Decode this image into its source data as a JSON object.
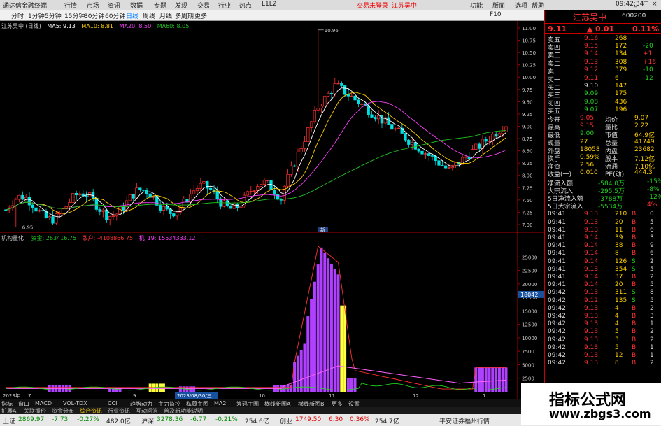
{
  "app": {
    "title": "通达信金融终端",
    "menu": [
      "行情",
      "市场",
      "资讯",
      "数据",
      "专题",
      "发现",
      "交易",
      "行业",
      "热点",
      "L1L2"
    ],
    "trade_login": "交易未登录",
    "stock_name_top": "江苏吴中",
    "right_menu": [
      "功能",
      "版面",
      "选项",
      "帮助"
    ],
    "clock": "09:42:34",
    "window_buttons": [
      "_",
      "□",
      "×"
    ]
  },
  "toolbar": {
    "periods": [
      "分时",
      "1分钟",
      "5分钟",
      "15分钟",
      "30分钟",
      "60分钟",
      "日线",
      "周线",
      "月线",
      "多周期",
      "更多"
    ],
    "selected": "日线",
    "right_icons": [
      "F10"
    ]
  },
  "kline": {
    "legend_name": "江苏吴中 (日线)",
    "ma5": "MA5: 9.13",
    "ma10": "MA10: 8.81",
    "ma20": "MA20: 8.50",
    "ma60": "MA60: 8.05",
    "high_label": "10.96",
    "low_label": "6.95",
    "axis_ticks": [
      "11.00",
      "10.75",
      "10.50",
      "10.25",
      "10.00",
      "9.75",
      "9.50",
      "9.25",
      "9.00",
      "8.75",
      "8.50",
      "8.25",
      "8.00",
      "7.75",
      "7.50",
      "7.25",
      "7.00"
    ],
    "colors": {
      "up": "#ff3030",
      "down": "#00e0e0",
      "ma5": "#ffffff",
      "ma10": "#ffd000",
      "ma20": "#ff40ff",
      "ma60": "#20c020"
    }
  },
  "indicator": {
    "legend_name": "机构量化",
    "legend_a": "资金: 263416.75",
    "legend_b": "散户: -4108866.75",
    "legend_c": "机_19: 15534333.12",
    "axis_ticks": [
      "25000",
      "22500",
      "20000",
      "17500",
      "15000",
      "12500",
      "10000",
      "7500",
      "5000",
      "2500"
    ],
    "cursor_value": "18042",
    "date_label": "2023/08/30/三",
    "x_labels": [
      "2023年",
      "7",
      "9",
      "10",
      "11",
      "12",
      "1"
    ],
    "marker_label": "新"
  },
  "bottom_tabs": [
    "指标",
    "窗口",
    "MACD",
    "VOL-TDX",
    "CCI",
    "趋势动力",
    "主力监控",
    "私募主图",
    "MA2",
    "筹码主图",
    "横线新图A",
    "横线新图B",
    "更多",
    "设置"
  ],
  "bottom_tabs2": [
    "扩展A",
    "关联报价",
    "资金分布",
    "综合资讯",
    "行业资讯",
    "互动问答",
    "普及新功能说明"
  ],
  "quote": {
    "name": "江苏吴中",
    "code": "600200",
    "price": "9.11",
    "change": "0.01",
    "pct": "0.11%",
    "asks": [
      {
        "label": "卖五",
        "price": "9.16",
        "vol": "268",
        "chg": ""
      },
      {
        "label": "卖四",
        "price": "9.15",
        "vol": "172",
        "chg": "-20"
      },
      {
        "label": "卖三",
        "price": "9.14",
        "vol": "134",
        "chg": "+1"
      },
      {
        "label": "卖二",
        "price": "9.13",
        "vol": "308",
        "chg": "+16"
      },
      {
        "label": "卖一",
        "price": "9.12",
        "vol": "379",
        "chg": "-10"
      }
    ],
    "bids": [
      {
        "label": "买一",
        "price": "9.11",
        "vol": "6",
        "chg": "-12"
      },
      {
        "label": "买二",
        "price": "9.10",
        "vol": "147",
        "chg": ""
      },
      {
        "label": "买三",
        "price": "9.09",
        "vol": "175",
        "chg": ""
      },
      {
        "label": "买四",
        "price": "9.08",
        "vol": "436",
        "chg": ""
      },
      {
        "label": "买五",
        "price": "9.07",
        "vol": "196",
        "chg": ""
      }
    ],
    "stats": [
      {
        "k1": "今开",
        "v1": "9.05",
        "k2": "均价",
        "v2": "9.07"
      },
      {
        "k1": "最高",
        "v1": "9.15",
        "k2": "量比",
        "v2": "2.22"
      },
      {
        "k1": "最低",
        "v1": "9.00",
        "k2": "市值",
        "v2": "64.9亿"
      },
      {
        "k1": "现量",
        "v1": "27",
        "k2": "总量",
        "v2": "41749"
      },
      {
        "k1": "外盘",
        "v1": "18058",
        "k2": "内盘",
        "v2": "23682"
      },
      {
        "k1": "换手",
        "v1": "0.59%",
        "k2": "股本",
        "v2": "7.12亿"
      },
      {
        "k1": "净资",
        "v1": "2.56",
        "k2": "流通",
        "v2": "7.10亿"
      },
      {
        "k1": "收益(一)",
        "v1": "0.010",
        "k2": "PE(动)",
        "v2": "444.3"
      }
    ],
    "flows": [
      {
        "label": "净流入额",
        "value": "-584.0万",
        "pct": "-15%"
      },
      {
        "label": "大宗流入",
        "value": "-295.5万",
        "pct": "-8%"
      },
      {
        "label": "5日净流入额",
        "value": "-3788万",
        "pct": "-12%"
      },
      {
        "label": "5日大宗流入",
        "value": "-5534万",
        "pct": "4%"
      }
    ],
    "ticks": [
      {
        "t": "09:41",
        "p": "9.13",
        "v": "210",
        "d": "B",
        "n": "0"
      },
      {
        "t": "09:41",
        "p": "9.13",
        "v": "20",
        "d": "B",
        "n": "5"
      },
      {
        "t": "09:41",
        "p": "9.13",
        "v": "11",
        "d": "B",
        "n": "6"
      },
      {
        "t": "09:41",
        "p": "9.14",
        "v": "39",
        "d": "B",
        "n": "3"
      },
      {
        "t": "09:41",
        "p": "9.14",
        "v": "38",
        "d": "B",
        "n": "9"
      },
      {
        "t": "09:41",
        "p": "9.14",
        "v": "8",
        "d": "B",
        "n": "6"
      },
      {
        "t": "09:41",
        "p": "9.14",
        "v": "126",
        "d": "S",
        "n": "2"
      },
      {
        "t": "09:41",
        "p": "9.13",
        "v": "354",
        "d": "S",
        "n": "5"
      },
      {
        "t": "09:41",
        "p": "9.14",
        "v": "37",
        "d": "B",
        "n": "2"
      },
      {
        "t": "09:41",
        "p": "9.14",
        "v": "20",
        "d": "B",
        "n": "5"
      },
      {
        "t": "09:42",
        "p": "9.13",
        "v": "311",
        "d": "S",
        "n": "8"
      },
      {
        "t": "09:42",
        "p": "9.12",
        "v": "135",
        "d": "S",
        "n": "5"
      },
      {
        "t": "09:42",
        "p": "9.13",
        "v": "4",
        "d": "B",
        "n": "2"
      },
      {
        "t": "09:42",
        "p": "9.13",
        "v": "4",
        "d": "B",
        "n": "3"
      },
      {
        "t": "09:42",
        "p": "9.13",
        "v": "4",
        "d": "B",
        "n": "1"
      },
      {
        "t": "09:42",
        "p": "9.13",
        "v": "5",
        "d": "B",
        "n": "2"
      },
      {
        "t": "09:42",
        "p": "9.13",
        "v": "3",
        "d": "B",
        "n": "2"
      },
      {
        "t": "09:42",
        "p": "9.13",
        "v": "5",
        "d": "B",
        "n": "1"
      },
      {
        "t": "09:42",
        "p": "9.13",
        "v": "12",
        "d": "B",
        "n": "1"
      },
      {
        "t": "09:42",
        "p": "9.13",
        "v": "8",
        "d": "B",
        "n": "2"
      }
    ]
  },
  "status": {
    "items": [
      {
        "label": "上证",
        "value": "2869.97",
        "chg": "-7.73",
        "pct": "-0.27%",
        "amt": "482.0亿"
      },
      {
        "label": "沪深",
        "value": "3278.36",
        "chg": "-6.77",
        "pct": "-0.21%",
        "amt": "254.6亿"
      },
      {
        "label": "创业",
        "value": "1749.50",
        "chg": "6.30",
        "pct": "0.36%",
        "amt": "254.7亿"
      }
    ],
    "server": "平安证券福州行情"
  },
  "watermark": {
    "title": "指标公式网",
    "url": "www.zbgs3.com"
  }
}
